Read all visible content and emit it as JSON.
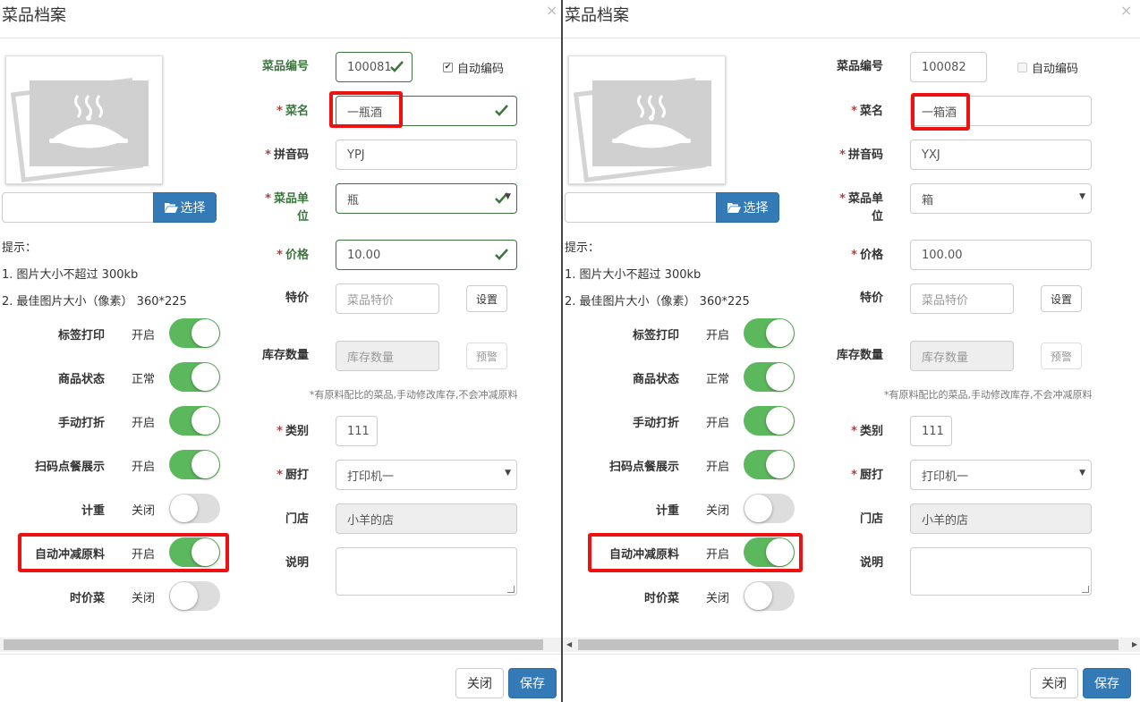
{
  "left": {
    "title": "菜品档案",
    "close_symbol": "×",
    "upload": {
      "button_label": "选择"
    },
    "tips": [
      "提示：",
      "1. 图片大小不超过 300kb",
      "2. 最佳图片大小（像素） 360*225"
    ],
    "switches": [
      {
        "label": "标签打印",
        "state": "开启",
        "on": true
      },
      {
        "label": "商品状态",
        "state": "正常",
        "on": true
      },
      {
        "label": "手动打折",
        "state": "开启",
        "on": true
      },
      {
        "label": "扫码点餐展示",
        "state": "开启",
        "on": true
      },
      {
        "label": "计重",
        "state": "关闭",
        "on": false
      },
      {
        "label": "自动冲减原料",
        "state": "开启",
        "on": true
      },
      {
        "label": "时价菜",
        "state": "关闭",
        "on": false
      }
    ],
    "form": {
      "code_label": "菜品编号",
      "code_value": "100081",
      "auto_code_label": "自动编码",
      "auto_code_checked": true,
      "req_mark": "*",
      "name_label": "菜名",
      "name_value": "一瓶酒",
      "pinyin_label": "拼音码",
      "pinyin_value": "YPJ",
      "unit_label_1": "菜品单",
      "unit_label_2": "位",
      "unit_value": "瓶",
      "price_label": "价格",
      "price_value": "10.00",
      "special_label": "特价",
      "special_placeholder": "菜品特价",
      "special_button": "设置",
      "stock_label": "库存数量",
      "stock_placeholder": "库存数量",
      "stock_button": "预警",
      "stock_note": "*有原料配比的菜品,手动修改库存,不会冲减原料",
      "category_label": "类别",
      "category_value": "111",
      "printer_label": "厨打",
      "printer_value": "打印机一",
      "store_label": "门店",
      "store_value": "小羊的店",
      "desc_label": "说明",
      "desc_value": ""
    },
    "footer": {
      "close_label": "关闭",
      "save_label": "保存"
    }
  },
  "right": {
    "title": "菜品档案",
    "close_symbol": "×",
    "upload": {
      "button_label": "选择"
    },
    "tips": [
      "提示：",
      "1. 图片大小不超过 300kb",
      "2. 最佳图片大小（像素） 360*225"
    ],
    "switches": [
      {
        "label": "标签打印",
        "state": "开启",
        "on": true
      },
      {
        "label": "商品状态",
        "state": "正常",
        "on": true
      },
      {
        "label": "手动打折",
        "state": "开启",
        "on": true
      },
      {
        "label": "扫码点餐展示",
        "state": "开启",
        "on": true
      },
      {
        "label": "计重",
        "state": "关闭",
        "on": false
      },
      {
        "label": "自动冲减原料",
        "state": "开启",
        "on": true
      },
      {
        "label": "时价菜",
        "state": "关闭",
        "on": false
      }
    ],
    "form": {
      "code_label": "菜品编号",
      "code_value": "100082",
      "auto_code_label": "自动编码",
      "auto_code_checked": false,
      "req_mark": "*",
      "name_label": "菜名",
      "name_value": "一箱酒",
      "pinyin_label": "拼音码",
      "pinyin_value": "YXJ",
      "unit_label_1": "菜品单",
      "unit_label_2": "位",
      "unit_value": "箱",
      "price_label": "价格",
      "price_value": "100.00",
      "special_label": "特价",
      "special_placeholder": "菜品特价",
      "special_button": "设置",
      "stock_label": "库存数量",
      "stock_placeholder": "库存数量",
      "stock_button": "预警",
      "stock_note": "*有原料配比的菜品,手动修改库存,不会冲减原料",
      "category_label": "类别",
      "category_value": "111",
      "printer_label": "厨打",
      "printer_value": "打印机一",
      "store_label": "门店",
      "store_value": "小羊的店",
      "desc_label": "说明",
      "desc_value": ""
    },
    "footer": {
      "close_label": "关闭",
      "save_label": "保存"
    }
  },
  "colors": {
    "primary": "#337ab7",
    "success": "#3c763d",
    "switch_on": "#5cb85c",
    "switch_off": "#dddddd",
    "required": "#a94442",
    "highlight": "#ee1111"
  }
}
